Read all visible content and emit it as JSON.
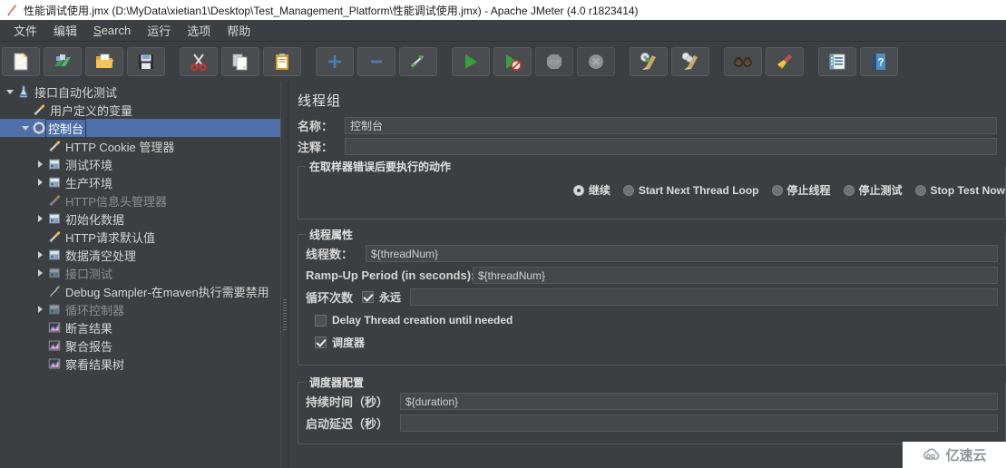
{
  "window": {
    "title": "性能调试使用.jmx (D:\\MyData\\xietian1\\Desktop\\Test_Management_Platform\\性能调试使用.jmx) - Apache JMeter (4.0 r1823414)",
    "app_icon": "jmeter-feather-icon"
  },
  "menubar": {
    "items": [
      {
        "label": "文件",
        "mnemonic": ""
      },
      {
        "label": "编辑",
        "mnemonic": ""
      },
      {
        "label": "Search",
        "mnemonic": "S"
      },
      {
        "label": "运行",
        "mnemonic": ""
      },
      {
        "label": "选项",
        "mnemonic": ""
      },
      {
        "label": "帮助",
        "mnemonic": ""
      }
    ]
  },
  "toolbar": {
    "buttons": [
      {
        "name": "new-icon",
        "tip": "新建",
        "disabled": false
      },
      {
        "name": "templates-icon",
        "tip": "模板",
        "disabled": false
      },
      {
        "name": "open-icon",
        "tip": "打开",
        "disabled": false
      },
      {
        "name": "save-icon",
        "tip": "保存",
        "disabled": false
      },
      {
        "name": "cut-icon",
        "tip": "剪切",
        "disabled": false
      },
      {
        "name": "copy-icon",
        "tip": "复制",
        "disabled": false
      },
      {
        "name": "paste-icon",
        "tip": "粘贴",
        "disabled": false
      },
      {
        "name": "expand-all-icon",
        "tip": "展开全部",
        "disabled": false
      },
      {
        "name": "collapse-all-icon",
        "tip": "折叠全部",
        "disabled": false
      },
      {
        "name": "toggle-icon",
        "tip": "切换",
        "disabled": false
      },
      {
        "name": "start-icon",
        "tip": "启动",
        "disabled": false
      },
      {
        "name": "start-no-pauses-icon",
        "tip": "无暂停启动",
        "disabled": false
      },
      {
        "name": "stop-icon",
        "tip": "停止",
        "disabled": true
      },
      {
        "name": "shutdown-icon",
        "tip": "关闭",
        "disabled": true
      },
      {
        "name": "clear-icon",
        "tip": "清除",
        "disabled": false
      },
      {
        "name": "clear-all-icon",
        "tip": "清除全部",
        "disabled": false
      },
      {
        "name": "search-icon",
        "tip": "查找",
        "disabled": false
      },
      {
        "name": "reset-search-icon",
        "tip": "重置查找",
        "disabled": false
      },
      {
        "name": "function-helper-icon",
        "tip": "函数助手对话框",
        "disabled": false
      },
      {
        "name": "help-icon",
        "tip": "帮助",
        "disabled": false
      }
    ]
  },
  "tree": {
    "nodes": [
      {
        "label": "接口自动化测试",
        "depth": 0,
        "twisty": "open",
        "icon": "test-plan-icon",
        "selected": false,
        "disabled": false
      },
      {
        "label": "用户定义的变量",
        "depth": 1,
        "twisty": "none",
        "icon": "config-icon",
        "selected": false,
        "disabled": false
      },
      {
        "label": "控制台",
        "depth": 1,
        "twisty": "open",
        "icon": "thread-group-icon",
        "selected": true,
        "disabled": false
      },
      {
        "label": "HTTP Cookie 管理器",
        "depth": 2,
        "twisty": "none",
        "icon": "config-icon",
        "selected": false,
        "disabled": false
      },
      {
        "label": "测试环境",
        "depth": 2,
        "twisty": "closed",
        "icon": "controller-icon",
        "selected": false,
        "disabled": false
      },
      {
        "label": "生产环境",
        "depth": 2,
        "twisty": "closed",
        "icon": "controller-icon",
        "selected": false,
        "disabled": false
      },
      {
        "label": "HTTP信息头管理器",
        "depth": 2,
        "twisty": "none",
        "icon": "config-icon",
        "selected": false,
        "disabled": true
      },
      {
        "label": "初始化数据",
        "depth": 2,
        "twisty": "closed",
        "icon": "controller-icon",
        "selected": false,
        "disabled": false
      },
      {
        "label": "HTTP请求默认值",
        "depth": 2,
        "twisty": "none",
        "icon": "config-icon",
        "selected": false,
        "disabled": false
      },
      {
        "label": "数据清空处理",
        "depth": 2,
        "twisty": "closed",
        "icon": "controller-icon",
        "selected": false,
        "disabled": false
      },
      {
        "label": "接口测试",
        "depth": 2,
        "twisty": "closed",
        "icon": "controller-icon",
        "selected": false,
        "disabled": true
      },
      {
        "label": "Debug Sampler-在maven执行需要禁用",
        "depth": 2,
        "twisty": "none",
        "icon": "sampler-icon",
        "selected": false,
        "disabled": false
      },
      {
        "label": "循环控制器",
        "depth": 2,
        "twisty": "closed",
        "icon": "controller-icon",
        "selected": false,
        "disabled": true
      },
      {
        "label": "断言结果",
        "depth": 2,
        "twisty": "none",
        "icon": "listener-icon",
        "selected": false,
        "disabled": false
      },
      {
        "label": "聚合报告",
        "depth": 2,
        "twisty": "none",
        "icon": "listener-icon",
        "selected": false,
        "disabled": false
      },
      {
        "label": "察看结果树",
        "depth": 2,
        "twisty": "none",
        "icon": "listener-icon",
        "selected": false,
        "disabled": false
      }
    ]
  },
  "panel": {
    "title": "线程组",
    "name_label": "名称：",
    "name_value": "控制台",
    "comment_label": "注释：",
    "comment_value": "",
    "error_action": {
      "group_title": "在取样器错误后要执行的动作",
      "options": [
        {
          "label": "继续",
          "selected": true
        },
        {
          "label": "Start Next Thread Loop",
          "selected": false
        },
        {
          "label": "停止线程",
          "selected": false
        },
        {
          "label": "停止测试",
          "selected": false
        },
        {
          "label": "Stop Test Now",
          "selected": false
        }
      ]
    },
    "thread_properties": {
      "group_title": "线程属性",
      "num_threads_label": "线程数：",
      "num_threads_value": "${threadNum}",
      "ramp_up_label": "Ramp-Up Period (in seconds):",
      "ramp_up_value": "${threadNum}",
      "loop_count_label": "循环次数",
      "forever_label": "永远",
      "forever_checked": true,
      "loop_count_value": "",
      "delay_creation_label": "Delay Thread creation until needed",
      "delay_creation_checked": false,
      "scheduler_label": "调度器",
      "scheduler_checked": true
    },
    "scheduler_config": {
      "group_title": "调度器配置",
      "duration_label": "持续时间（秒）",
      "duration_value": "${duration}",
      "startup_delay_label": "启动延迟（秒）",
      "startup_delay_value": ""
    }
  },
  "watermark": {
    "text": "亿速云",
    "icon": "cloud-icon"
  },
  "colors": {
    "window_bg": "#3c3f41",
    "titlebar_bg": "#ffffff",
    "selection_blue": "#4e6fa8",
    "field_bg": "#45484a",
    "border": "#54585b",
    "text": "#d4d4d4",
    "text_dim": "#8b8e90"
  }
}
